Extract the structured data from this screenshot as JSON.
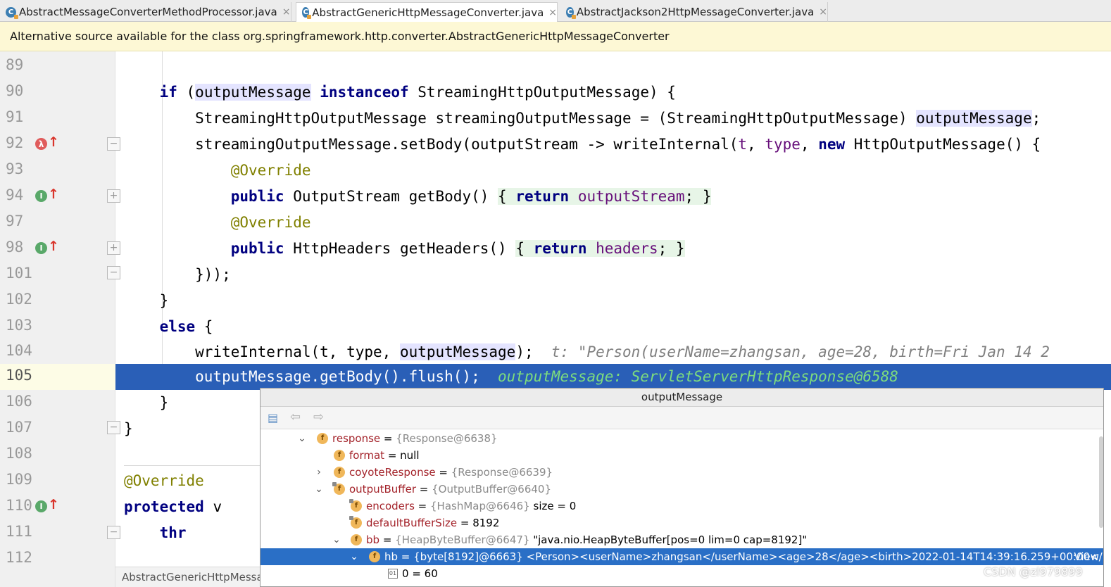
{
  "tabs": [
    {
      "label": "AbstractMessageConverterMethodProcessor.java",
      "icon": "class-icon",
      "close": "×"
    },
    {
      "label": "AbstractGenericHttpMessageConverter.java",
      "icon": "class-icon",
      "close": "×",
      "active": true
    },
    {
      "label": "AbstractJackson2HttpMessageConverter.java",
      "icon": "class-icon",
      "close": "×"
    }
  ],
  "banner": "Alternative source available for the class org.springframework.http.converter.AbstractGenericHttpMessageConverter",
  "editor": {
    "line_numbers": [
      "89",
      "90",
      "91",
      "92",
      "93",
      "94",
      "97",
      "98",
      "101",
      "102",
      "103",
      "104",
      "105",
      "106",
      "107",
      "108",
      "109",
      "110",
      "111",
      "112"
    ],
    "current_line": "105",
    "inline_hint_104": "t: \"Person(userName=zhangsan, age=28, birth=Fri Jan 14 2",
    "inline_hint_105": "outputMessage: ServletServerHttpResponse@6588"
  },
  "status_bar": "AbstractGenericHttpMessa",
  "popup": {
    "title": "outputMessage",
    "rows": [
      {
        "name": "response",
        "eq": " = ",
        "ref": "{Response@6638}",
        "extra": ""
      },
      {
        "name": "format",
        "eq": " = ",
        "ref": "",
        "extra": "null"
      },
      {
        "name": "coyoteResponse",
        "eq": " = ",
        "ref": "{Response@6639}",
        "extra": ""
      },
      {
        "name": "outputBuffer",
        "eq": " = ",
        "ref": "{OutputBuffer@6640}",
        "extra": ""
      },
      {
        "name": "encoders",
        "eq": " = ",
        "ref": "{HashMap@6646}",
        "extra": "  size = 0"
      },
      {
        "name": "defaultBufferSize",
        "eq": " = ",
        "ref": "",
        "extra": "8192"
      },
      {
        "name": "bb",
        "eq": " = ",
        "ref": "{HeapByteBuffer@6647}",
        "extra": " \"java.nio.HeapByteBuffer[pos=0 lim=0 cap=8192]\""
      },
      {
        "name": "hb",
        "eq": " = ",
        "ref": "{byte[8192]@6663}",
        "extra": " <Person><userName>zhangsan</userName><age>28</age><birth>2022-01-14T14:39:16.259+00:00</bi..."
      },
      {
        "name": "0",
        "eq": " = ",
        "ref": "",
        "extra": "60"
      }
    ],
    "view_link": "View"
  },
  "watermark": "CSDN @zl979899"
}
